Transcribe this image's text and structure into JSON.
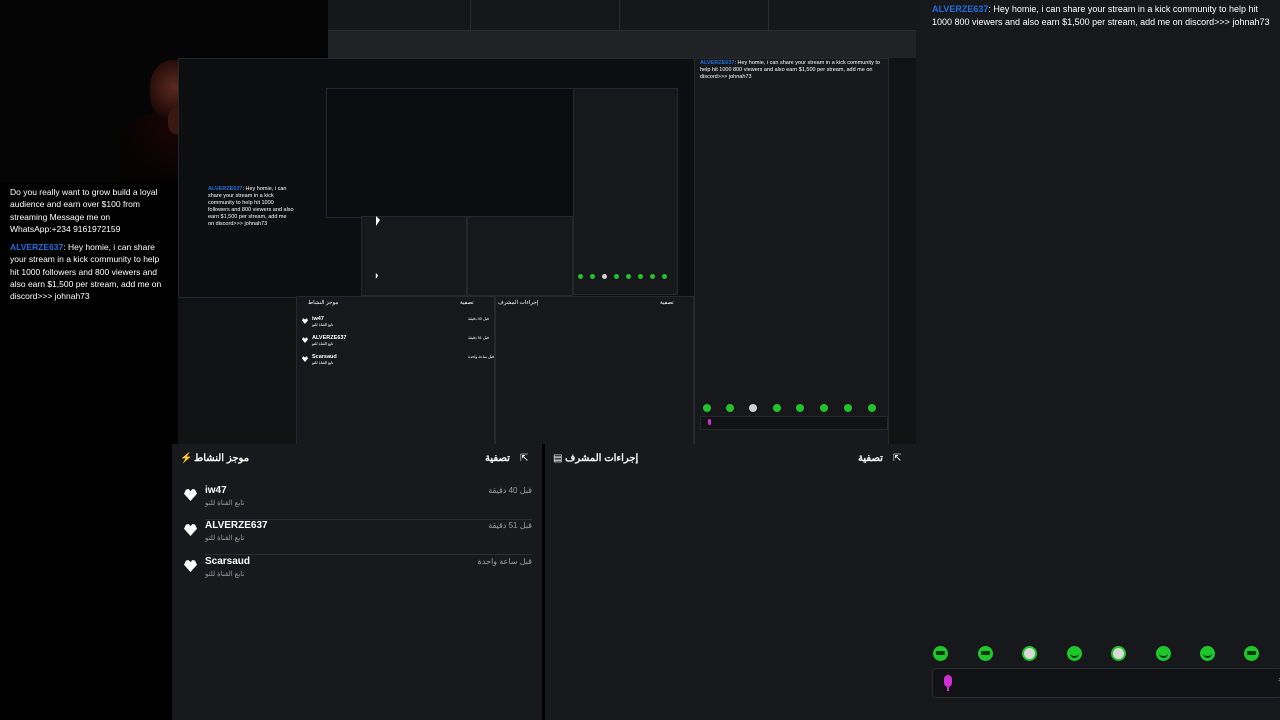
{
  "overlay_chat": {
    "messages": [
      {
        "text": "Do you really want to grow build a loyal audience and earn over $100 from streaming Message me on WhatsApp:+234 9161972159"
      },
      {
        "username": "ALVERZE637",
        "text": ": Hey homie, i can share your stream in a kick community to help hit 1000 followers and 800 viewers and also earn $1,500 per stream, add me on discord>>> johnah73"
      }
    ]
  },
  "activity_feed": {
    "title": "موجز النشاط",
    "filter_label": "تصفية",
    "items": [
      {
        "username": "iw47",
        "action": "تابع القناة للتو",
        "time": "قبل 40 دقيقة"
      },
      {
        "username": "ALVERZE637",
        "action": "تابع القناة للتو",
        "time": "قبل 51 دقيقة"
      },
      {
        "username": "Scarsaud",
        "action": "تابع القناة للتو",
        "time": "قبل ساعة واحدة"
      }
    ]
  },
  "mod_actions": {
    "title": "إجراءات المشرف",
    "filter_label": "تصفية"
  },
  "chat": {
    "username": "ALVERZE637",
    "message": ": Hey homie, i can share your stream in a kick community to help hit 1000 800 viewers and also earn $1,500 per stream, add me on discord>>> johnah73",
    "send_hint": "د"
  },
  "colors": {
    "username": "#1e6fe0",
    "emote_green": "#1fc82a",
    "mic": "#cf2fd3",
    "panel_bg": "#18191c"
  },
  "icons": {
    "heart": "heart-icon",
    "bolt": "bolt-icon",
    "expand": "expand-icon",
    "mod": "shield-icon",
    "mic": "mic-icon"
  }
}
